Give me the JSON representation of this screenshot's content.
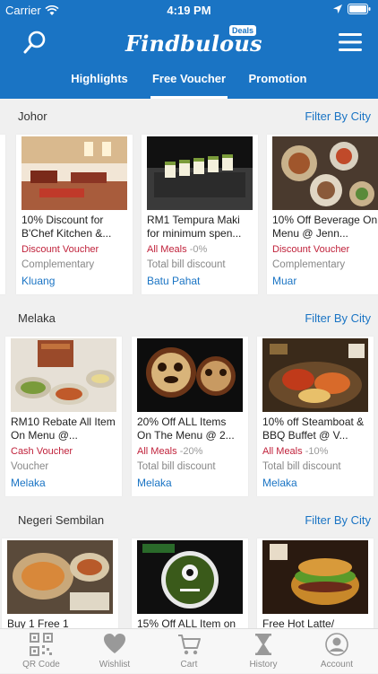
{
  "status": {
    "carrier": "Carrier",
    "time": "4:19 PM"
  },
  "header": {
    "logo_text": "Findbulous",
    "logo_badge": "Deals",
    "tabs": [
      {
        "label": "Highlights",
        "active": false
      },
      {
        "label": "Free Voucher",
        "active": true
      },
      {
        "label": "Promotion",
        "active": false
      }
    ]
  },
  "sections": [
    {
      "region": "Johor",
      "filter_label": "Filter By City",
      "cards": [
        {
          "name": "10% Discount for B'Chef Kitchen &...",
          "type": "Discount Voucher",
          "type_suffix": "",
          "desc": "Complementary",
          "city": "Kluang"
        },
        {
          "name": "RM1 Tempura Maki for minimum spen...",
          "type": "All Meals",
          "type_suffix": "-0%",
          "desc": "Total bill discount",
          "city": "Batu Pahat"
        },
        {
          "name": "10% Off Beverage On Menu @ Jenn...",
          "type": "Discount Voucher",
          "type_suffix": "",
          "desc": "Complementary",
          "city": "Muar"
        }
      ]
    },
    {
      "region": "Melaka",
      "filter_label": "Filter By City",
      "cards": [
        {
          "name": "RM10 Rebate All Item On Menu @...",
          "type": "Cash Voucher",
          "type_suffix": "",
          "desc": "Voucher",
          "city": "Melaka"
        },
        {
          "name": "20% Off ALL Items On The Menu @ 2...",
          "type": "All Meals",
          "type_suffix": "-20%",
          "desc": "Total bill discount",
          "city": "Melaka"
        },
        {
          "name": "10% off Steamboat & BBQ Buffet @ V...",
          "type": "All Meals",
          "type_suffix": "-10%",
          "desc": "Total bill discount",
          "city": "Melaka"
        }
      ]
    },
    {
      "region": "Negeri Sembilan",
      "filter_label": "Filter By City",
      "cards": [
        {
          "name": "Buy 1 Free 1",
          "type": "",
          "type_suffix": "",
          "desc": "",
          "city": ""
        },
        {
          "name": "15% Off ALL Item on",
          "type": "",
          "type_suffix": "",
          "desc": "",
          "city": ""
        },
        {
          "name": "Free Hot Latte/",
          "type": "",
          "type_suffix": "",
          "desc": "",
          "city": ""
        }
      ]
    }
  ],
  "tabbar": [
    {
      "label": "QR Code",
      "icon": "qr-code-icon"
    },
    {
      "label": "Wishlist",
      "icon": "heart-icon"
    },
    {
      "label": "Cart",
      "icon": "cart-icon"
    },
    {
      "label": "History",
      "icon": "hourglass-icon"
    },
    {
      "label": "Account",
      "icon": "user-icon"
    }
  ],
  "colors": {
    "brand": "#1a74c4",
    "accent_red": "#c0223b",
    "muted": "#888888"
  }
}
